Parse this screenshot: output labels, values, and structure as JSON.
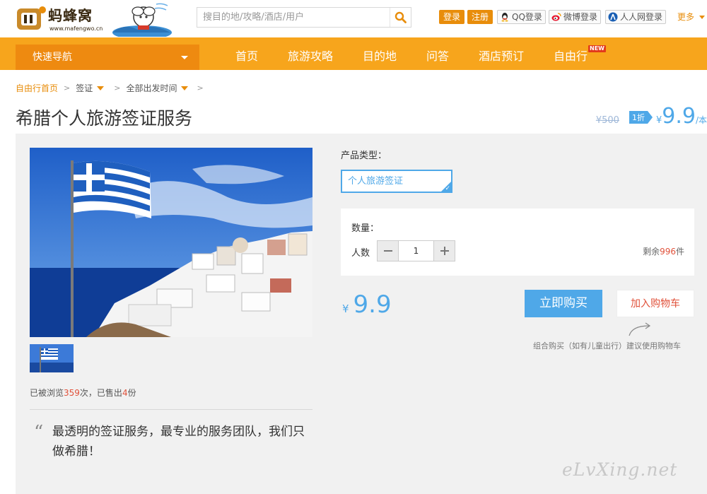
{
  "header": {
    "logo_text": "蚂蜂窝",
    "logo_url": "www.mafengwo.cn",
    "search_placeholder": "搜目的地/攻略/酒店/用户",
    "login": "登录",
    "register": "注册",
    "qq_login": "QQ登录",
    "weibo_login": "微博登录",
    "renren_login": "人人网登录",
    "more": "更多"
  },
  "nav": {
    "quick_nav": "快速导航",
    "items": [
      "首页",
      "旅游攻略",
      "目的地",
      "问答",
      "酒店预订",
      "自由行"
    ],
    "new_badge": "NEW"
  },
  "breadcrumb": {
    "home": "自由行首页",
    "visa": "签证",
    "departure": "全部出发时间"
  },
  "product": {
    "title": "希腊个人旅游签证服务",
    "old_price": "¥500",
    "discount": "1折",
    "currency": "¥",
    "price": "9.9",
    "unit": "/本",
    "type_label": "产品类型：",
    "type_option": "个人旅游签证",
    "qty_label": "数量：",
    "people_label": "人数",
    "qty_value": "1",
    "remain_prefix": "剩余",
    "remain_count": "996",
    "remain_suffix": "件",
    "buy_now": "立即购买",
    "add_cart": "加入购物车",
    "cart_hint": "组合购买（如有儿童出行）建议使用购物车",
    "stats_prefix": "已被浏览",
    "views": "359",
    "stats_mid": "次，已售出",
    "sold": "4",
    "stats_suffix": "份",
    "quote": "最透明的签证服务，最专业的服务团队，我们只做希腊！"
  },
  "watermark": "eLvXing.net",
  "colors": {
    "brand_orange": "#f7a51c",
    "accent_blue": "#4fa8e8",
    "highlight_red": "#e0513a"
  }
}
